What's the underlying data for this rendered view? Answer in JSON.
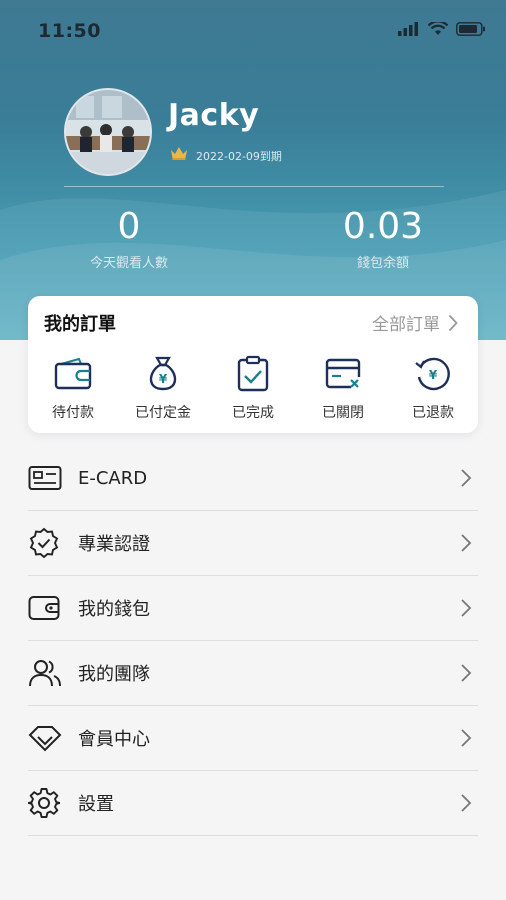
{
  "status_bar": {
    "time": "11:50"
  },
  "profile": {
    "name": "Jacky",
    "expiry": "2022-02-09到期"
  },
  "stats": [
    {
      "value": "0",
      "label": "今天觀看人數"
    },
    {
      "value": "0.03",
      "label": "錢包余額"
    }
  ],
  "orders": {
    "title": "我的訂單",
    "all_label": "全部訂單",
    "items": [
      {
        "label": "待付款",
        "icon": "wallet-icon"
      },
      {
        "label": "已付定金",
        "icon": "money-bag-icon"
      },
      {
        "label": "已完成",
        "icon": "clipboard-check-icon"
      },
      {
        "label": "已關閉",
        "icon": "card-close-icon"
      },
      {
        "label": "已退款",
        "icon": "refund-icon"
      }
    ]
  },
  "menu": [
    {
      "label": "E-CARD",
      "icon": "id-card-icon"
    },
    {
      "label": "專業認證",
      "icon": "certified-badge-icon"
    },
    {
      "label": "我的錢包",
      "icon": "wallet-icon"
    },
    {
      "label": "我的團隊",
      "icon": "team-icon"
    },
    {
      "label": "會員中心",
      "icon": "diamond-icon"
    },
    {
      "label": "設置",
      "icon": "gear-icon"
    }
  ],
  "colors": {
    "accent": "#1a7f8c",
    "icon_dark": "#1e2f5a",
    "header_top": "#3f7992",
    "header_bottom": "#5aaec2"
  }
}
